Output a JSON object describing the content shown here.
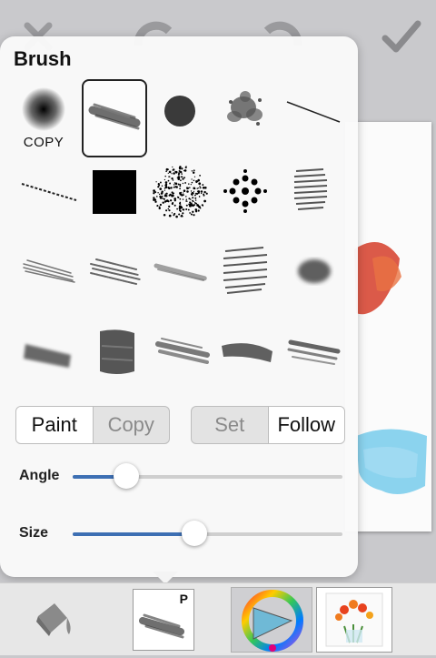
{
  "toolbar": {
    "close_icon": "close-icon",
    "undo_icon": "undo-icon",
    "redo_icon": "redo-icon",
    "confirm_icon": "checkmark-icon"
  },
  "popup": {
    "title": "Brush",
    "copy_brush_label": "COPY",
    "brushes": [
      "soft-round",
      "chalk-stroke",
      "hard-round",
      "splatter",
      "thin-line",
      "dotted-line",
      "square",
      "spray",
      "dots-pattern",
      "hatch-stack",
      "pencil-lines",
      "rough-pencil",
      "charcoal-stroke",
      "cross-hatch",
      "smudge",
      "ink-stroke",
      "wet-block",
      "dry-brush",
      "flat-wash",
      "bristle-stroke"
    ],
    "selected_brush": "chalk-stroke",
    "mode_segment": {
      "options": [
        "Paint",
        "Copy"
      ],
      "selected": "Paint"
    },
    "angle_segment": {
      "options": [
        "Set",
        "Follow"
      ],
      "selected": "Follow"
    },
    "angle": {
      "label": "Angle",
      "value": 0.2
    },
    "size": {
      "label": "Size",
      "value": 0.45
    }
  },
  "bottom": {
    "fill_icon": "paint-bucket-icon",
    "brush_badge": "P",
    "color_icon": "color-wheel-icon",
    "colors": {
      "accent": "#3d6fb3",
      "triangle": "#6fb9d6"
    },
    "layers_icon": "layer-thumbnail-icon"
  }
}
